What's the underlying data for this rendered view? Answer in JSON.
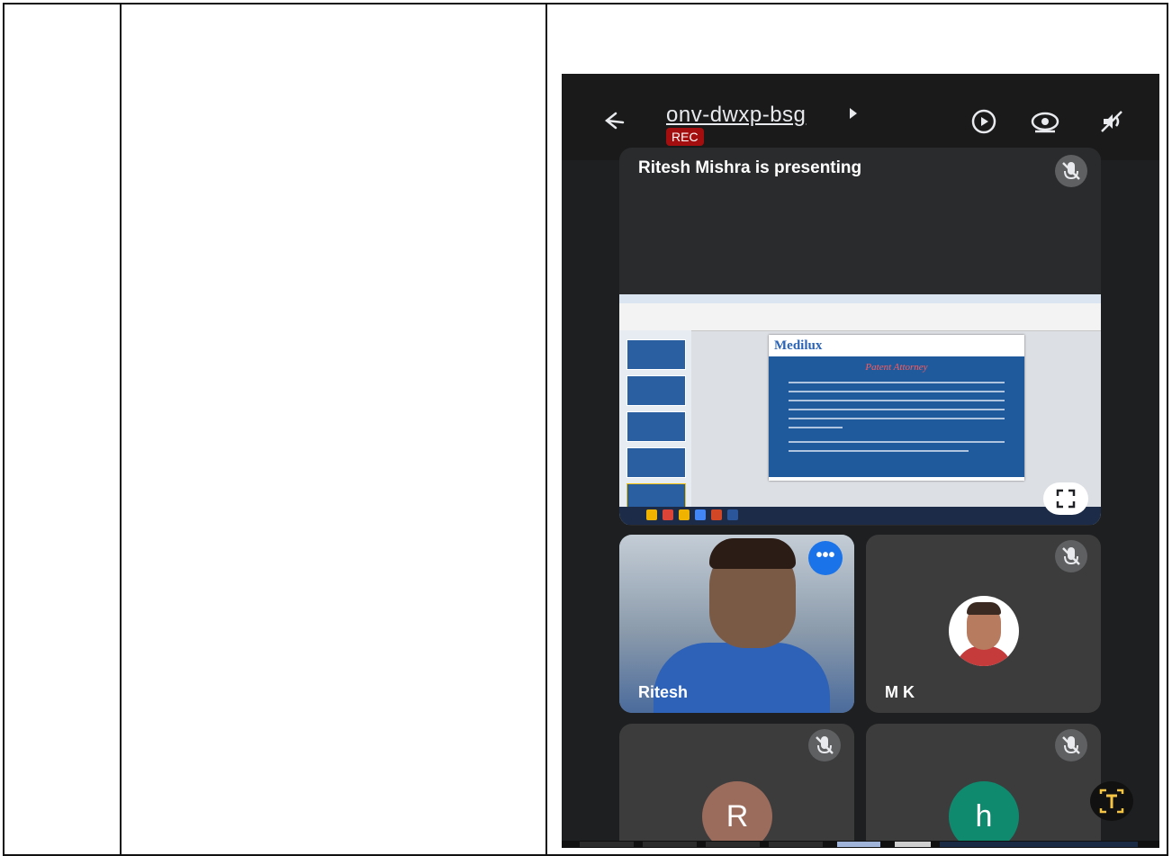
{
  "meeting": {
    "code": "onv-dwxp-bsg",
    "rec_badge": "REC",
    "presenting_label": "Ritesh Mishra is presenting"
  },
  "shared_screen": {
    "slide_logo": "Medilux",
    "slide_title": "Patent Attorney"
  },
  "participants": [
    {
      "name": "Ritesh",
      "more_label": "•••"
    },
    {
      "name": "M K"
    },
    {
      "initial": "R",
      "color": "#9b6b5c"
    },
    {
      "initial": "h",
      "color": "#0f8a6f"
    }
  ],
  "colors": {
    "background": "#1e1f20",
    "tile": "#3c3c3d",
    "rec": "#a50e0e",
    "accent": "#1a73e8"
  }
}
